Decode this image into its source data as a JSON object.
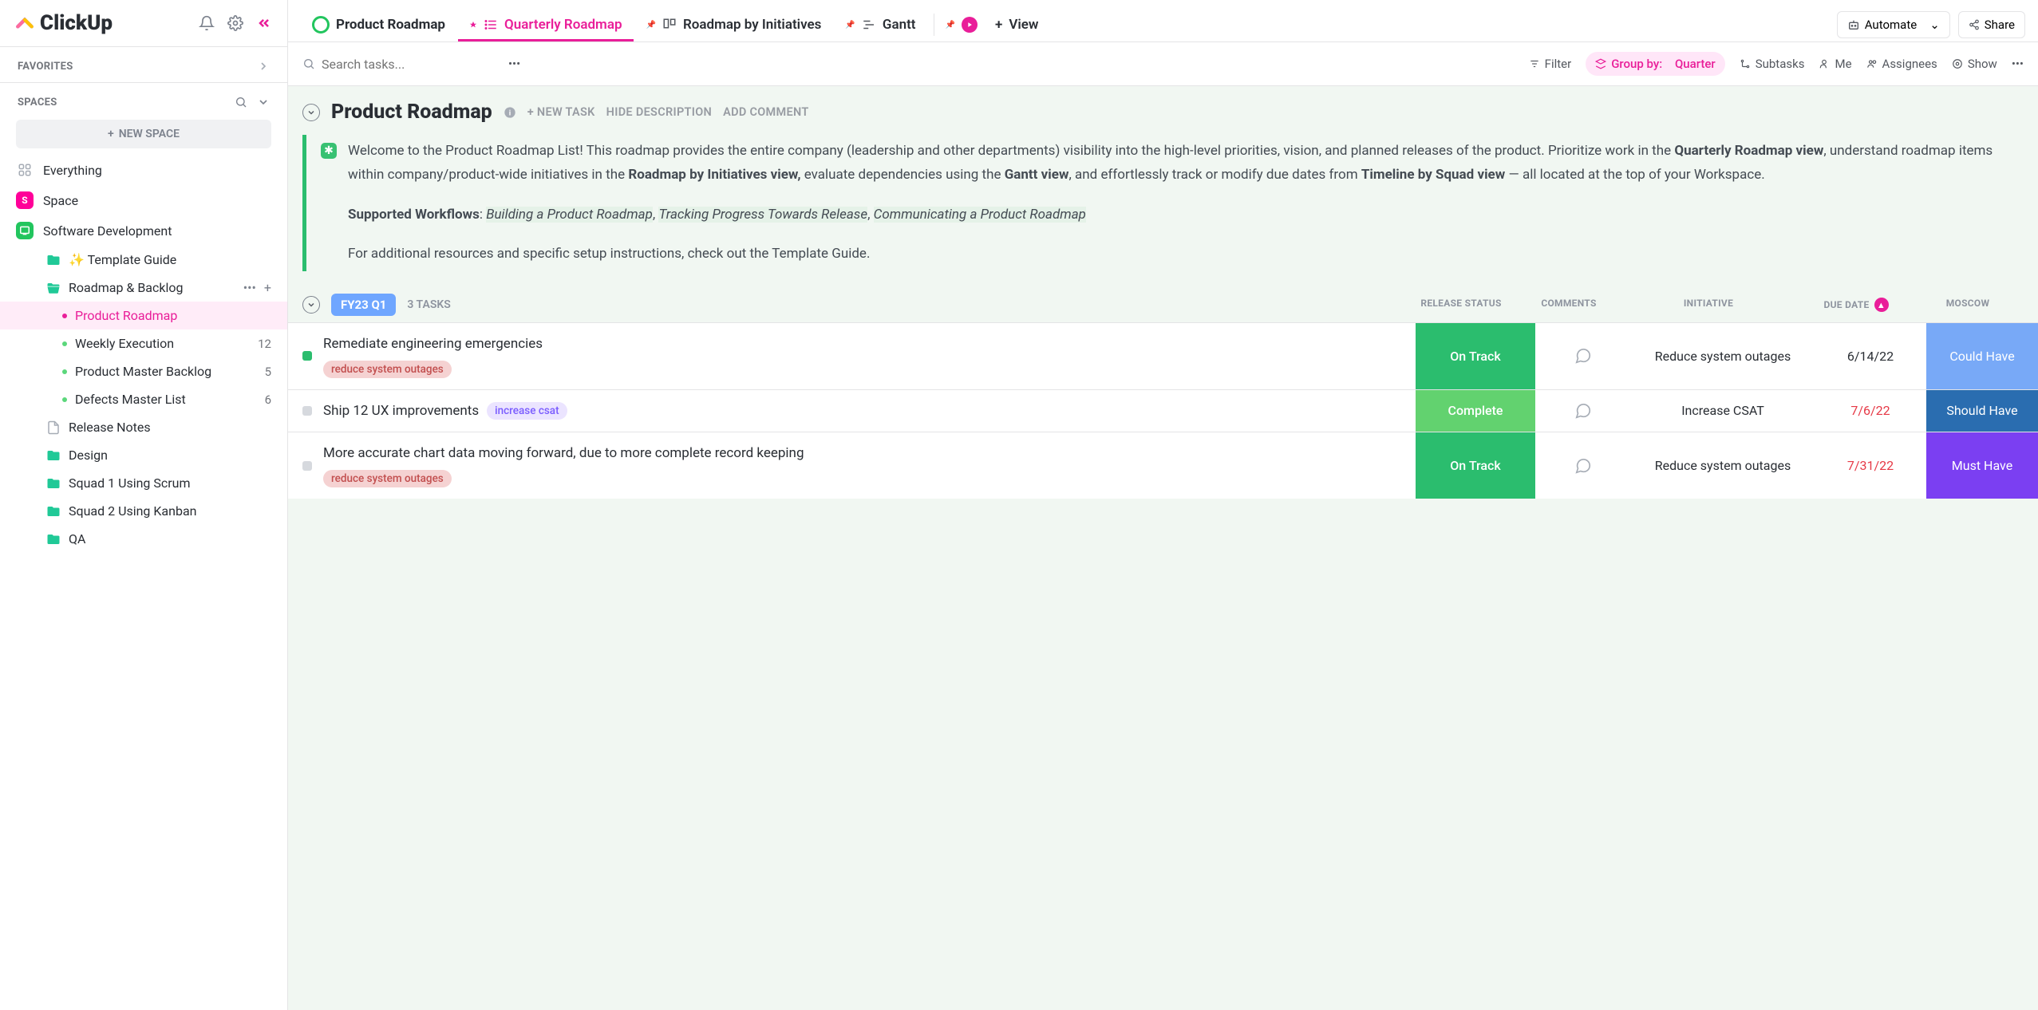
{
  "app": {
    "name": "ClickUp"
  },
  "sidebar": {
    "favorites": "FAVORITES",
    "spaces": "SPACES",
    "new_space": "NEW SPACE",
    "items": {
      "everything": "Everything",
      "space": "Space",
      "software": "Software Development"
    },
    "tree": {
      "template_guide": "✨ Template Guide",
      "roadmap_backlog": "Roadmap & Backlog",
      "product_roadmap": "Product Roadmap",
      "weekly_execution": {
        "label": "Weekly Execution",
        "count": "12"
      },
      "product_master_backlog": {
        "label": "Product Master Backlog",
        "count": "5"
      },
      "defects_master_list": {
        "label": "Defects Master List",
        "count": "6"
      },
      "release_notes": "Release Notes",
      "design": "Design",
      "squad1": "Squad 1 Using Scrum",
      "squad2": "Squad 2 Using Kanban",
      "qa": "QA"
    }
  },
  "tabs": {
    "title": "Product Roadmap",
    "quarterly": "Quarterly Roadmap",
    "initiatives": "Roadmap by Initiatives",
    "gantt": "Gantt",
    "view": "View",
    "automate": "Automate",
    "share": "Share"
  },
  "toolbar": {
    "search_placeholder": "Search tasks...",
    "filter": "Filter",
    "group_label": "Group by:",
    "group_value": "Quarter",
    "subtasks": "Subtasks",
    "me": "Me",
    "assignees": "Assignees",
    "show": "Show"
  },
  "header": {
    "title": "Product Roadmap",
    "new_task": "+ NEW TASK",
    "hide_desc": "HIDE DESCRIPTION",
    "add_comment": "ADD COMMENT"
  },
  "description": {
    "p1a": "Welcome to the Product Roadmap List! This roadmap provides the entire company (leadership and other departments) visibility into the high-level priorities, vision, and planned releases of the product. Prioritize work in the ",
    "b1": "Quarterly Roadmap view",
    "p1b": ", understand roadmap items within company/product-wide initiatives in the ",
    "b2": "Roadmap by Initiatives view,",
    "p1c": " evaluate dependencies using the ",
    "b3": "Gantt view",
    "p1d": ", and effortlessly track or modify due dates from ",
    "b4": "Timeline by Squad view",
    "p1e": " — all located at the top of your Workspace.",
    "p2a": "Supported Workflows",
    "wf1": "Building a Product Roadmap",
    "wf2": "Tracking Progress Towards Release",
    "wf3": "Communicating a Product Roadmap",
    "p3": "For additional resources and specific setup instructions, check out the Template Guide."
  },
  "group": {
    "label": "FY23 Q1",
    "count": "3 TASKS"
  },
  "columns": {
    "status": "RELEASE STATUS",
    "comments": "COMMENTS",
    "initiative": "INITIATIVE",
    "due": "DUE DATE",
    "moscow": "MOSCOW"
  },
  "tasks": [
    {
      "title": "Remediate engineering emergencies",
      "tag": "reduce system outages",
      "tag_class": "red",
      "status": "On Track",
      "status_class": "bg-ontrack",
      "initiative": "Reduce system outages",
      "due": "6/14/22",
      "due_red": false,
      "moscow": "Could Have",
      "moscow_class": "bg-could",
      "sq": "green"
    },
    {
      "title": "Ship 12 UX improvements",
      "tag": "increase csat",
      "tag_class": "purple",
      "status": "Complete",
      "status_class": "bg-complete",
      "initiative": "Increase CSAT",
      "due": "7/6/22",
      "due_red": true,
      "moscow": "Should Have",
      "moscow_class": "bg-should",
      "sq": "gray",
      "inline_tag": true
    },
    {
      "title": "More accurate chart data moving forward, due to more complete record keeping",
      "tag": "reduce system outages",
      "tag_class": "red",
      "status": "On Track",
      "status_class": "bg-ontrack",
      "initiative": "Reduce system outages",
      "due": "7/31/22",
      "due_red": true,
      "moscow": "Must Have",
      "moscow_class": "bg-must",
      "sq": "gray"
    }
  ]
}
